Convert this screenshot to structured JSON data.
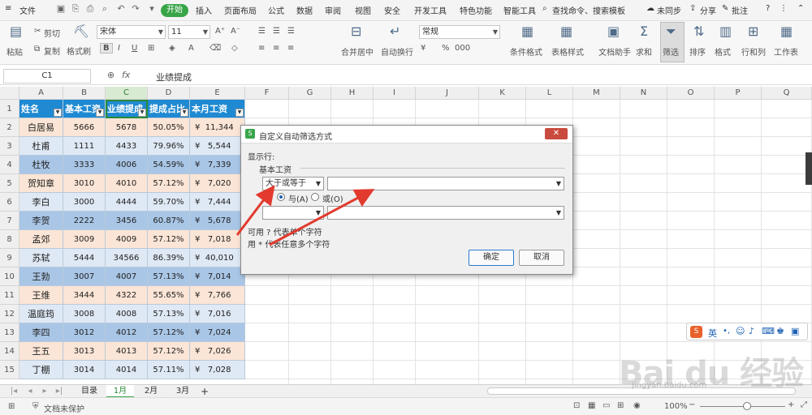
{
  "menu": {
    "file": "文件",
    "start": "开始",
    "items": [
      "插入",
      "页面布局",
      "公式",
      "数据",
      "审阅",
      "视图",
      "安全",
      "开发工具",
      "特色功能",
      "智能工具"
    ],
    "search": "查找命令、搜索模板",
    "sync": "未同步",
    "share": "分享",
    "comment": "批注"
  },
  "ribbon": {
    "paste": "粘贴",
    "cut": "剪切",
    "copy": "复制",
    "format_painter": "格式刷",
    "font": "宋体",
    "size": "11",
    "bold": "B",
    "italic": "I",
    "underline": "U",
    "merge": "合并居中",
    "wrap": "自动换行",
    "numfmt": "常规",
    "currency": "¥",
    "percent": "%",
    "thousands": "000",
    "cond_format": "条件格式",
    "table_style": "表格样式",
    "doc_helper": "文档助手",
    "sum": "求和",
    "filter": "筛选",
    "sort": "排序",
    "format": "格式",
    "rowcol": "行和列",
    "sheet": "工作表"
  },
  "formula_bar": {
    "cell": "C1",
    "fx": "fx",
    "value": "业绩提成"
  },
  "columns": [
    "A",
    "B",
    "C",
    "D",
    "E",
    "F",
    "G",
    "H",
    "I",
    "J",
    "K",
    "L",
    "M",
    "N",
    "O",
    "P",
    "Q"
  ],
  "rows": [
    "1",
    "2",
    "3",
    "4",
    "5",
    "6",
    "7",
    "8",
    "9",
    "10",
    "11",
    "12",
    "13",
    "14",
    "15"
  ],
  "table": {
    "headers": [
      "姓名",
      "基本工资",
      "业绩提成",
      "提成占比",
      "本月工资"
    ],
    "data": [
      [
        "白居易",
        "5666",
        "5678",
        "50.05%",
        "¥  11,344"
      ],
      [
        "杜甫",
        "1111",
        "4433",
        "79.96%",
        "¥   5,544"
      ],
      [
        "杜牧",
        "3333",
        "4006",
        "54.59%",
        "¥   7,339"
      ],
      [
        "贺知章",
        "3010",
        "4010",
        "57.12%",
        "¥   7,020"
      ],
      [
        "李白",
        "3000",
        "4444",
        "59.70%",
        "¥   7,444"
      ],
      [
        "李贺",
        "2222",
        "3456",
        "60.87%",
        "¥   5,678"
      ],
      [
        "孟郊",
        "3009",
        "4009",
        "57.12%",
        "¥   7,018"
      ],
      [
        "苏轼",
        "5444",
        "34566",
        "86.39%",
        "¥  40,010"
      ],
      [
        "王勃",
        "3007",
        "4007",
        "57.13%",
        "¥   7,014"
      ],
      [
        "王维",
        "3444",
        "4322",
        "55.65%",
        "¥   7,766"
      ],
      [
        "温庭筠",
        "3008",
        "4008",
        "57.13%",
        "¥   7,016"
      ],
      [
        "李四",
        "3012",
        "4012",
        "57.12%",
        "¥   7,024"
      ],
      [
        "王五",
        "3013",
        "4013",
        "57.12%",
        "¥   7,026"
      ],
      [
        "丁棚",
        "3014",
        "4014",
        "57.11%",
        "¥   7,028"
      ]
    ]
  },
  "sheets": [
    "目录",
    "1月",
    "2月",
    "3月"
  ],
  "status": {
    "protect": "文档未保护",
    "zoom": "100%"
  },
  "dialog": {
    "title": "自定义自动筛选方式",
    "show_rows": "显示行:",
    "field": "基本工资",
    "op1": "大于或等于",
    "value1": "",
    "and": "与(A)",
    "or": "或(O)",
    "op2": "",
    "value2": "",
    "hint1": "可用 ? 代表单个字符",
    "hint2": "用 * 代表任意多个字符",
    "ok": "确定",
    "cancel": "取消"
  },
  "watermark": "Bai du 经验",
  "watermark_url": "jingyan.baidu.com",
  "ime": {
    "label": "英"
  },
  "colors": {
    "accent": "#38a548",
    "header": "#1f8ad2",
    "arrow": "#e23a2e"
  }
}
